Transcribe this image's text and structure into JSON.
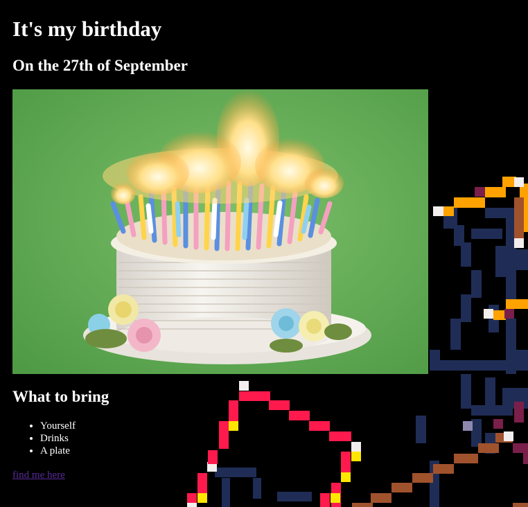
{
  "heading": "It's my birthday",
  "subheading": "On the 27th of September",
  "bring_heading": "What to bring",
  "bring_items": [
    "Yourself",
    "Drinks",
    "A plate"
  ],
  "link_text": "find me here",
  "colors": {
    "background": "#000000",
    "text": "#ffffff",
    "visited_link": "#5b2a9b",
    "photo_backdrop": "#6aa84f",
    "pixel_pink": "#ff1a4d",
    "pixel_navy": "#1f2d56",
    "pixel_orange": "#ffa200",
    "pixel_brown": "#a0522d",
    "pixel_maroon": "#7a1f4a"
  },
  "icons": {
    "photo": "birthday-cake-with-candles",
    "background": "pixel-art-line-figure"
  }
}
